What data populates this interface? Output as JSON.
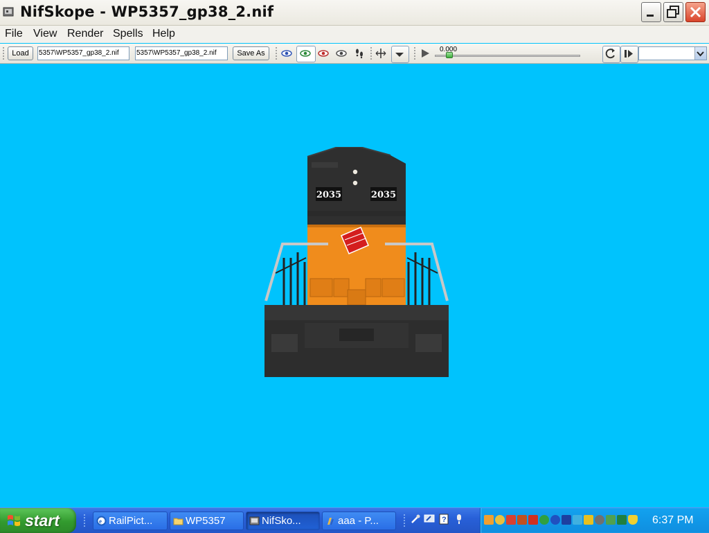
{
  "window": {
    "title": "NifSkope - WP5357_gp38_2.nif"
  },
  "menu": [
    "File",
    "View",
    "Render",
    "Spells",
    "Help"
  ],
  "toolbar": {
    "load_label": "Load",
    "load_path": "5357\\WP5357_gp38_2.nif",
    "save_path": "5357\\WP5357_gp38_2.nif",
    "save_label": "Save As",
    "time_value": "0.000",
    "time_progress": 0.08,
    "animation_select": ""
  },
  "viewport": {
    "background": "#00c3fd",
    "model": {
      "cab_number_left": "2035",
      "cab_number_right": "2035",
      "body_color": "#f08c1c",
      "cab_color": "#2e2e2e"
    }
  },
  "taskbar": {
    "start_label": "start",
    "tasks": [
      {
        "label": "RailPict...",
        "icon": "ie-icon"
      },
      {
        "label": "WP5357",
        "icon": "folder-icon"
      },
      {
        "label": "NifSko...",
        "icon": "nifskope-icon"
      },
      {
        "label": "aaa - P...",
        "icon": "paint-icon"
      }
    ],
    "clock": "6:37 PM"
  }
}
